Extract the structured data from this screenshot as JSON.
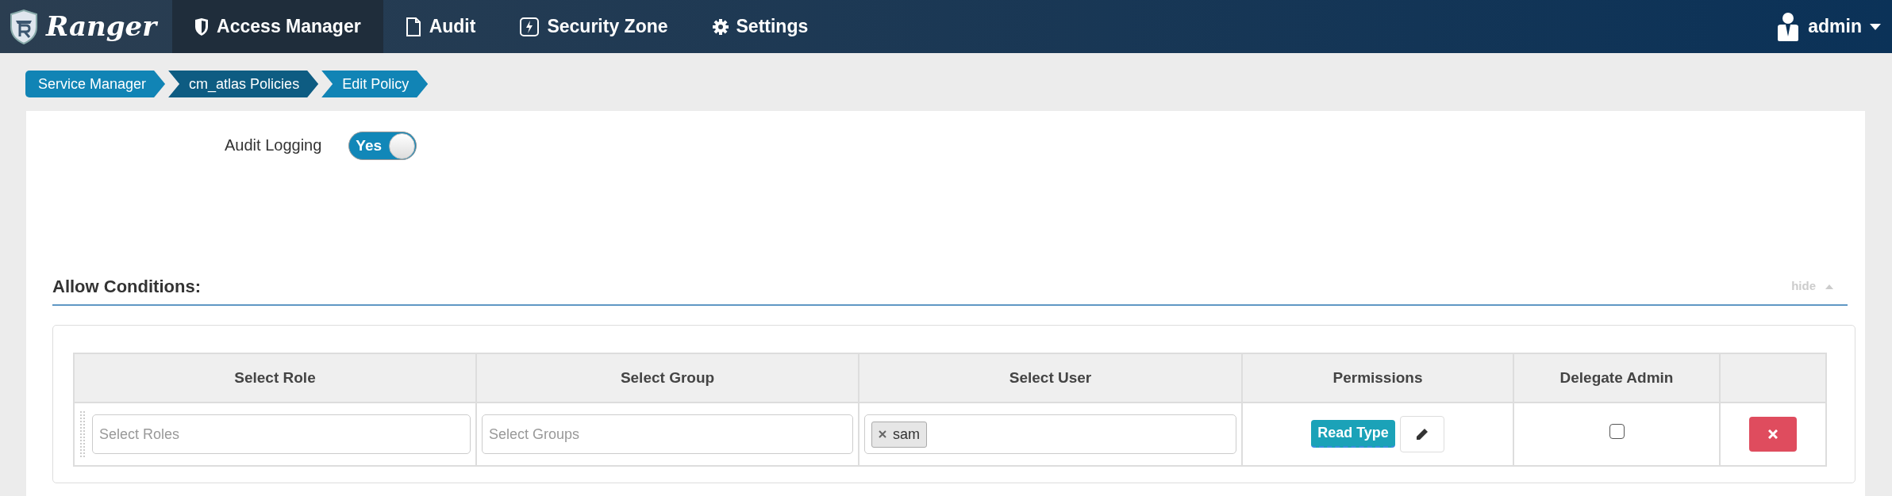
{
  "navbar": {
    "brand": "Ranger",
    "items": [
      {
        "label": "Access Manager",
        "kind": "shield",
        "selected": true
      },
      {
        "label": "Audit",
        "kind": "file",
        "selected": false
      },
      {
        "label": "Security Zone",
        "kind": "bolt",
        "selected": false
      },
      {
        "label": "Settings",
        "kind": "gear",
        "selected": false
      }
    ],
    "user": "admin"
  },
  "breadcrumb": [
    {
      "label": "Service Manager",
      "selected": false
    },
    {
      "label": "cm_atlas Policies",
      "selected": true
    },
    {
      "label": "Edit Policy",
      "selected": false
    }
  ],
  "audit_logging": {
    "label": "Audit Logging",
    "toggle": {
      "on": true,
      "label": "Yes"
    }
  },
  "allow_conditions": {
    "title": "Allow Conditions:",
    "toggle_link": "hide",
    "expanded": true,
    "table": {
      "columns": [
        "Select Role",
        "Select Group",
        "Select User",
        "Permissions",
        "Delegate Admin"
      ],
      "rows": [
        {
          "role": {
            "placeholder": "Select Roles"
          },
          "group": {
            "placeholder": "Select Groups"
          },
          "users": [
            "sam"
          ],
          "permissions": [
            "Read Type"
          ],
          "delegate_admin": false
        }
      ]
    }
  }
}
